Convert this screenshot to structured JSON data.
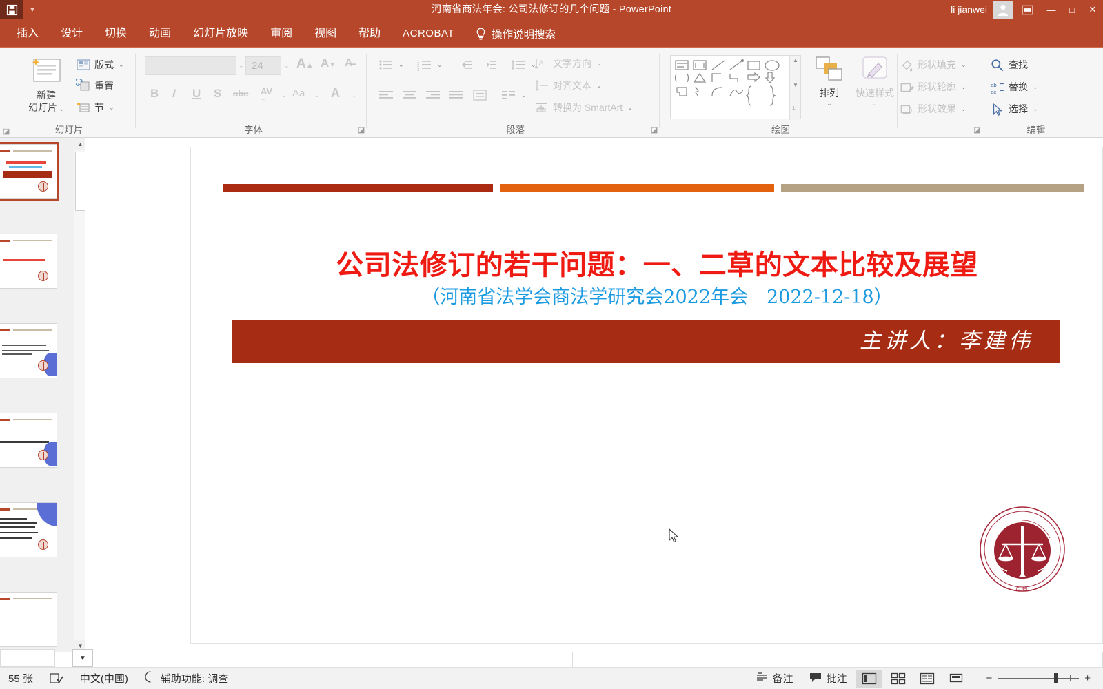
{
  "window": {
    "title": "河南省商法年会: 公司法修订的几个问题  -  PowerPoint",
    "user": "li jianwei",
    "quick_access": {
      "save": "save-icon",
      "customize": "chevron-down-icon"
    },
    "controls": {
      "minimize": "—",
      "maximize": "□",
      "close": "✕"
    }
  },
  "tabs": [
    {
      "label": "插入"
    },
    {
      "label": "设计"
    },
    {
      "label": "切换"
    },
    {
      "label": "动画"
    },
    {
      "label": "幻灯片放映"
    },
    {
      "label": "审阅"
    },
    {
      "label": "视图"
    },
    {
      "label": "帮助"
    },
    {
      "label": "ACROBAT"
    }
  ],
  "tell_me": {
    "label": "操作说明搜索",
    "icon": "lightbulb-icon"
  },
  "ribbon": {
    "groups": [
      {
        "name": "slides",
        "label": "幻灯片"
      },
      {
        "name": "font",
        "label": "字体"
      },
      {
        "name": "paragraph",
        "label": "段落"
      },
      {
        "name": "drawing",
        "label": "绘图"
      },
      {
        "name": "editing",
        "label": "编辑"
      }
    ],
    "slides": {
      "new_slide": "新建\n幻灯片",
      "new_slide_line1": "新建",
      "new_slide_line2": "幻灯片",
      "layout": "版式",
      "reset": "重置",
      "section": "节"
    },
    "font": {
      "font_name": "",
      "font_size": "24",
      "grow": "A",
      "shrink": "A",
      "clear_format": "clear-formatting-icon",
      "bold": "B",
      "italic": "I",
      "underline": "U",
      "shadow": "S",
      "strikethrough": "abc",
      "char_spacing": "AV",
      "change_case": "Aa",
      "font_color": "A"
    },
    "paragraph": {
      "text_direction": "文字方向",
      "align_text": "对齐文本",
      "convert_smartart": "转换为 SmartArt"
    },
    "drawing": {
      "arrange": "排列",
      "quick_styles": "快速样式",
      "shape_fill": "形状填充",
      "shape_outline": "形状轮廓",
      "shape_effects": "形状效果"
    },
    "editing": {
      "find": "查找",
      "replace": "替换",
      "select": "选择"
    }
  },
  "slide_panel": {
    "scroll_up": "▲",
    "scroll_down": "▼",
    "thumbnails": [
      {
        "index": 1,
        "selected": true
      },
      {
        "index": 2,
        "selected": false
      },
      {
        "index": 3,
        "selected": false
      },
      {
        "index": 4,
        "selected": false
      },
      {
        "index": 5,
        "selected": false
      },
      {
        "index": 6,
        "selected": false
      }
    ]
  },
  "slide": {
    "title": "公司法修订的若干问题：一、二草的文本比较及展望",
    "subtitle": "（河南省法学会商法学研究会2022年会　2022-12-18）",
    "banner_text": "主讲人：李建伟",
    "logo_name": "cupl-university-seal",
    "decorations": [
      {
        "color": "#ab2b12",
        "name": "deco-bar-red"
      },
      {
        "color": "#e2620f",
        "name": "deco-bar-orange"
      },
      {
        "color": "#b5a183",
        "name": "deco-bar-tan"
      }
    ],
    "colors": {
      "title": "#ef1a12",
      "subtitle": "#1a9ae0",
      "banner": "#a62d14"
    }
  },
  "status_bar": {
    "slide_count": "55 张",
    "spellcheck_icon": "spellcheck-icon",
    "language": "中文(中国)",
    "accessibility": "辅助功能: 调查",
    "notes": "备注",
    "comments": "批注",
    "views": [
      {
        "name": "normal-view",
        "active": true
      },
      {
        "name": "slide-sorter-view",
        "active": false
      },
      {
        "name": "reading-view",
        "active": false
      },
      {
        "name": "slideshow-view",
        "active": false
      }
    ],
    "zoom_out": "−",
    "zoom_in": "+"
  },
  "theme": {
    "ribbon_red": "#b7472a",
    "ribbon_dark": "#6f2a19",
    "ribbon_bg": "#f6f6f6"
  }
}
